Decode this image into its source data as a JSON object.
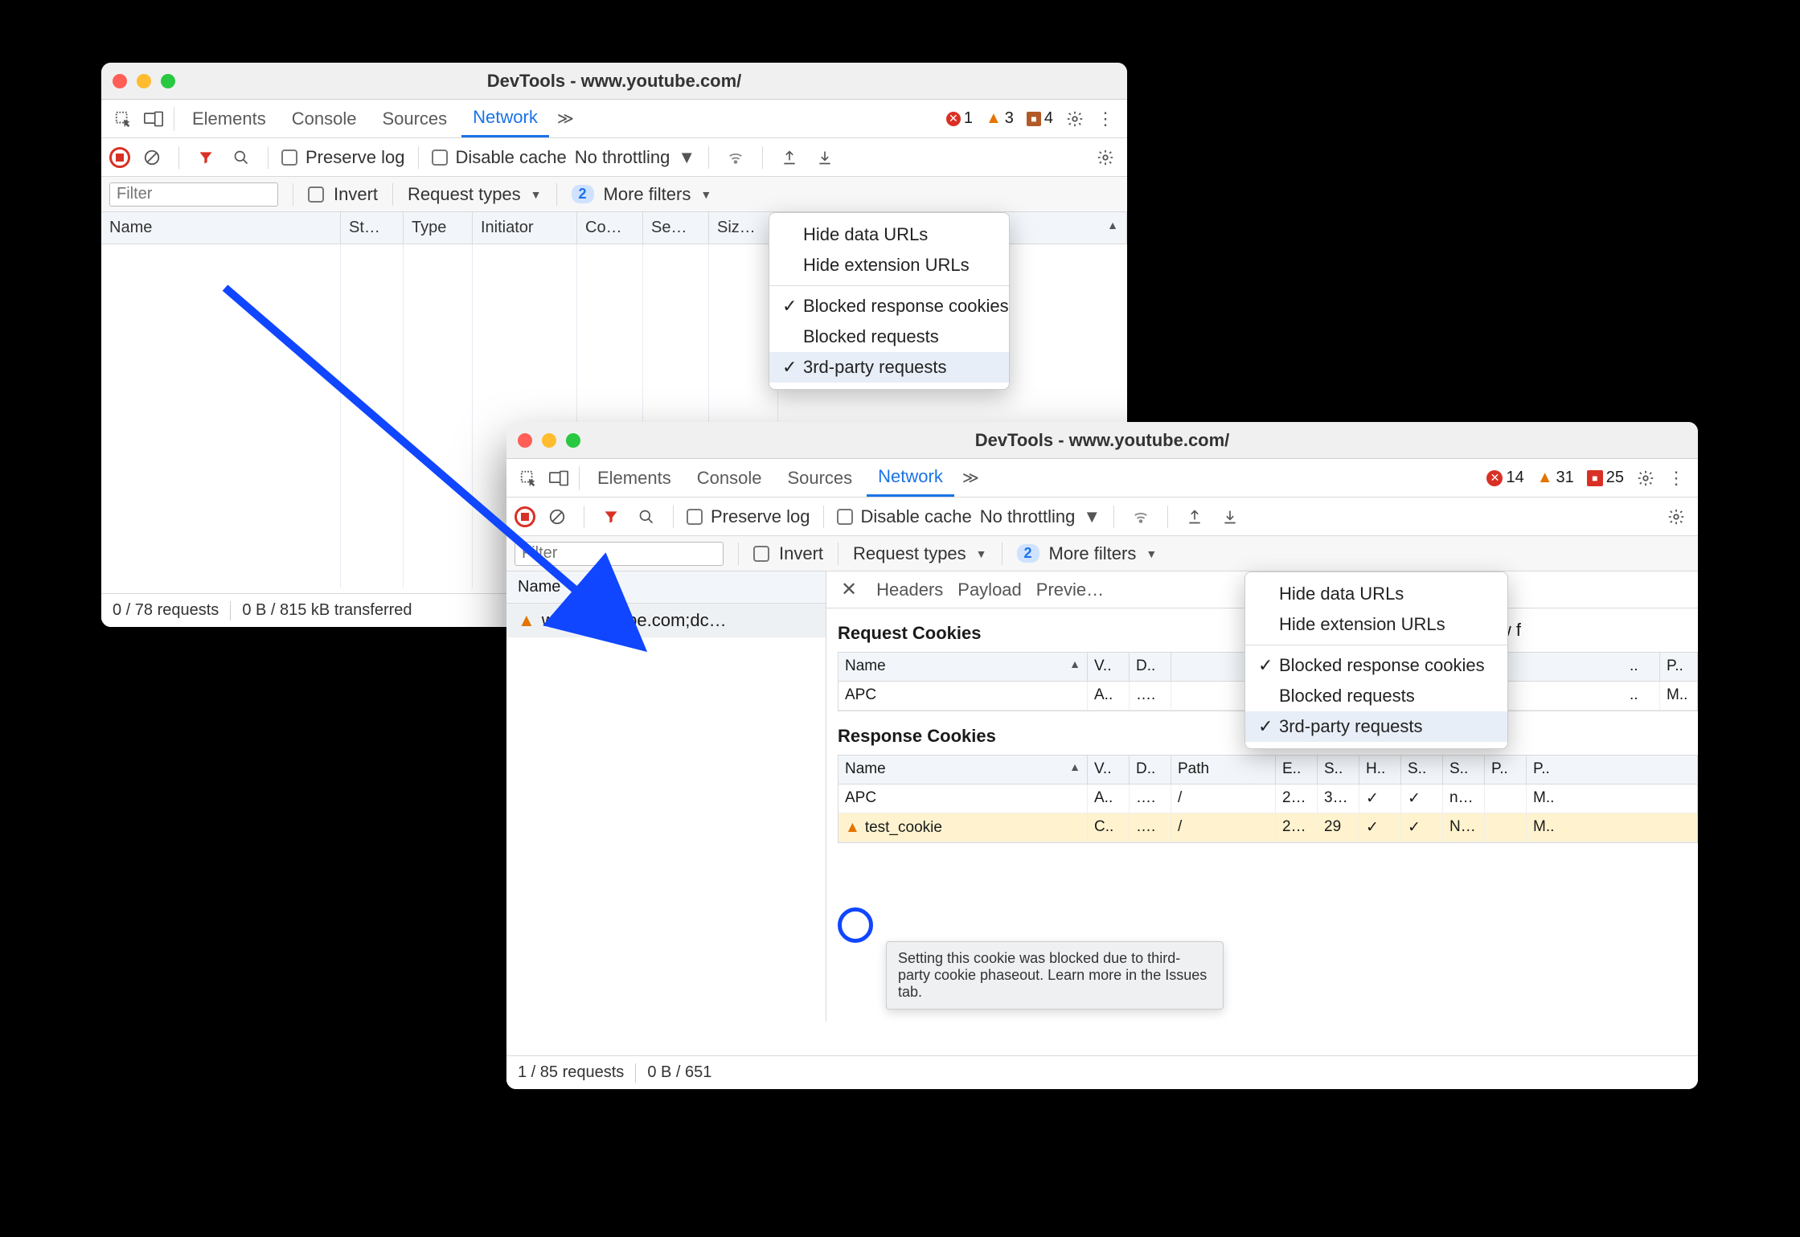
{
  "window1": {
    "title": "DevTools - www.youtube.com/",
    "tabs": [
      "Elements",
      "Console",
      "Sources",
      "Network"
    ],
    "active_tab": "Network",
    "errors": 1,
    "warnings": 3,
    "infos": 4,
    "toolbar": {
      "preserve_log": "Preserve log",
      "disable_cache": "Disable cache",
      "throttling": "No throttling"
    },
    "filter": {
      "placeholder": "Filter",
      "invert": "Invert",
      "request_types": "Request types",
      "more_filters": "More filters",
      "badge": "2"
    },
    "columns": [
      "Name",
      "St…",
      "Type",
      "Initiator",
      "Co…",
      "Se…",
      "Siz…"
    ],
    "dropdown": {
      "items": [
        {
          "label": "Hide data URLs",
          "checked": false
        },
        {
          "label": "Hide extension URLs",
          "checked": false
        },
        {
          "sep": true
        },
        {
          "label": "Blocked response cookies",
          "checked": true
        },
        {
          "label": "Blocked requests",
          "checked": false
        },
        {
          "label": "3rd-party requests",
          "checked": true,
          "hover": true
        }
      ]
    },
    "status": {
      "requests": "0 / 78 requests",
      "transferred": "0 B / 815 kB transferred"
    }
  },
  "window2": {
    "title": "DevTools - www.youtube.com/",
    "tabs": [
      "Elements",
      "Console",
      "Sources",
      "Network"
    ],
    "active_tab": "Network",
    "errors": 14,
    "warnings": 31,
    "issues": 25,
    "toolbar": {
      "preserve_log": "Preserve log",
      "disable_cache": "Disable cache",
      "throttling": "No throttling"
    },
    "filter": {
      "placeholder": "Filter",
      "invert": "Invert",
      "request_types": "Request types",
      "more_filters": "More filters",
      "badge": "2"
    },
    "dropdown": {
      "items": [
        {
          "label": "Hide data URLs",
          "checked": false
        },
        {
          "label": "Hide extension URLs",
          "checked": false
        },
        {
          "sep": true
        },
        {
          "label": "Blocked response cookies",
          "checked": true
        },
        {
          "label": "Blocked requests",
          "checked": false
        },
        {
          "label": "3rd-party requests",
          "checked": true,
          "hover": true
        }
      ]
    },
    "name_header": "Name",
    "request_item": "www.youtube.com;dc…",
    "detail_tabs": [
      "Headers",
      "Payload",
      "Previe…"
    ],
    "sections": {
      "request_cookies": "Request Cookies",
      "show_filtered": "show f",
      "response_cookies": "Response Cookies"
    },
    "req_table": {
      "headers": [
        "Name",
        "V..",
        "D.."
      ],
      "row": [
        "APC",
        "A..",
        "…."
      ]
    },
    "req_table_tail": [
      "",
      "",
      "..",
      "P.."
    ],
    "req_row_tail": [
      "",
      "",
      "..",
      "M.."
    ],
    "resp_table": {
      "headers": [
        "Name",
        "V..",
        "D..",
        "Path",
        "E..",
        "S..",
        "H..",
        "S..",
        "S..",
        "P..",
        "P.."
      ],
      "rows": [
        [
          "APC",
          "A..",
          "….",
          "/",
          "2…",
          "3…",
          "✓",
          "✓",
          "n…",
          "",
          "M.."
        ],
        [
          "test_cookie",
          "C..",
          "….",
          "/",
          "2…",
          "29",
          "✓",
          "✓",
          "N…",
          "",
          "M.."
        ]
      ]
    },
    "tooltip": "Setting this cookie was blocked due to third-party cookie phaseout. Learn more in the Issues tab.",
    "status": {
      "requests": "1 / 85 requests",
      "transferred": "0 B / 651"
    }
  }
}
